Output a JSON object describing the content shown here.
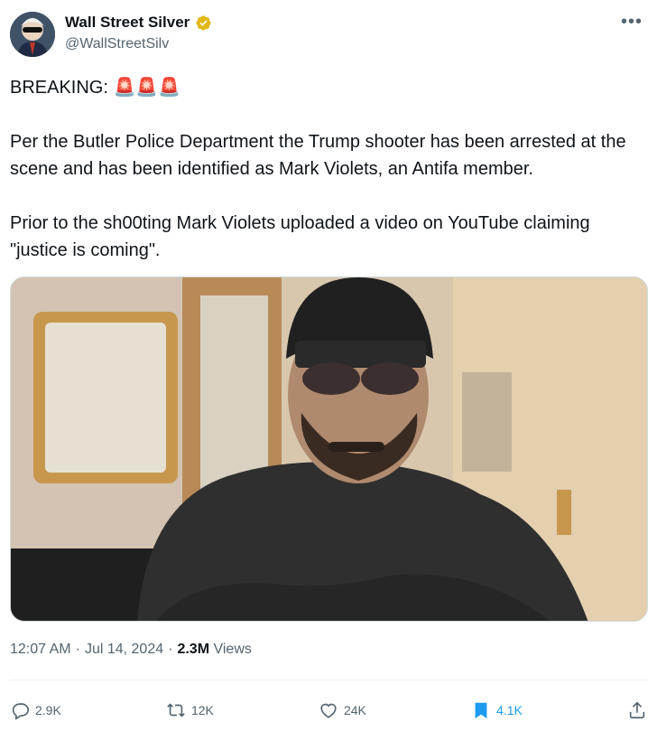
{
  "author": {
    "name": "Wall Street Silver",
    "handle": "@WallStreetSilv"
  },
  "menu_icon": "•••",
  "post": {
    "line_breaking": "BREAKING: 🚨🚨🚨",
    "paragraph1": "Per the Butler Police Department the Trump shooter has been arrested at the scene and has been identified as Mark Violets, an Antifa member.",
    "paragraph2": "Prior to the sh00ting Mark Violets uploaded a video on YouTube claiming \"justice is coming\"."
  },
  "meta": {
    "time": "12:07 AM",
    "separator": "·",
    "date": "Jul 14, 2024",
    "views_count": "2.3M",
    "views_label": "Views"
  },
  "actions": {
    "replies": "2.9K",
    "reposts": "12K",
    "likes": "24K",
    "bookmarks": "4.1K"
  },
  "colors": {
    "accent": "#1d9bf0",
    "secondary_text": "#536471",
    "verified_badge": "#e2b719"
  }
}
